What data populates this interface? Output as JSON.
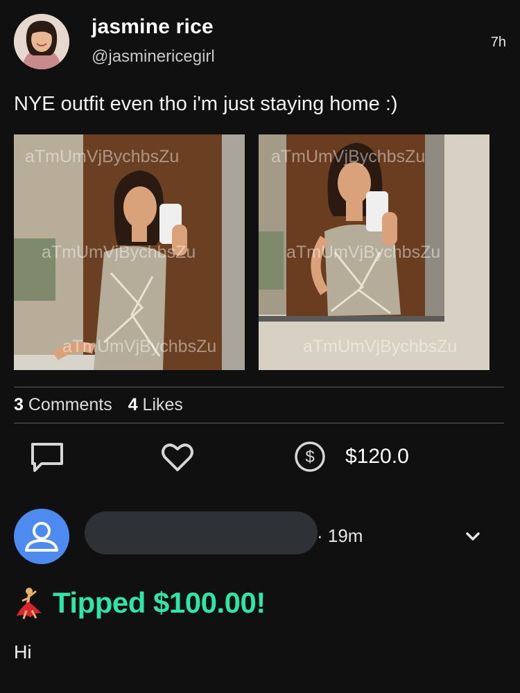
{
  "post": {
    "author": {
      "display_name": "jasmine rice",
      "handle": "@jasminericegirl"
    },
    "time_ago": "7h",
    "caption": "NYE outfit even tho i'm just staying home :)",
    "watermark": "aTmUmVjBychbsZu",
    "stats": {
      "comments_count": "3",
      "comments_label": "Comments",
      "likes_count": "4",
      "likes_label": "Likes"
    },
    "actions": {
      "tip_amount": "$120.0",
      "comment_icon": "comment-icon",
      "like_icon": "heart-icon",
      "tip_icon": "dollar-coin-icon"
    }
  },
  "comment": {
    "time": "· 19m",
    "tip_text": "Tipped $100.00!",
    "text": "Hi",
    "avatar_icon": "user-icon",
    "expand_icon": "chevron-down-icon"
  },
  "colors": {
    "background": "#101010",
    "tip_green": "#2ee6a8",
    "avatar_blue": "#4d8bf0",
    "divider": "#5a5a5a"
  }
}
